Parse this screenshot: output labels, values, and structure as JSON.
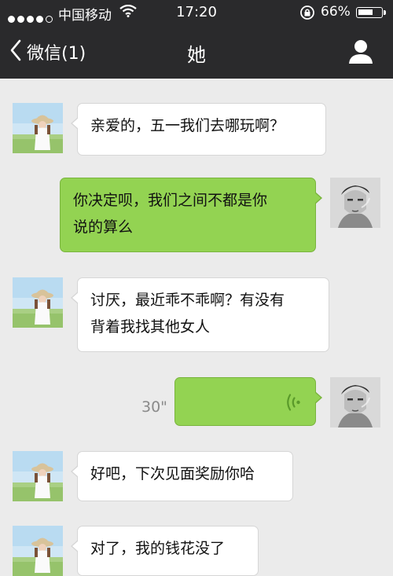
{
  "status_bar": {
    "carrier": "中国移动",
    "time": "17:20",
    "battery_percent": "66%",
    "battery_level": 0.66,
    "signal_bars_filled": 4,
    "signal_bars_total": 5,
    "icons": [
      "signal-dots-icon",
      "wifi-icon",
      "rotation-lock-icon",
      "battery-icon"
    ]
  },
  "nav": {
    "back_label": "微信",
    "unread_badge": "(1)",
    "title": "她",
    "icons": [
      "chevron-left-icon",
      "user-profile-icon"
    ]
  },
  "messages": [
    {
      "from": "her",
      "text_lines": [
        "亲爱的，五一我们去哪玩啊？"
      ]
    },
    {
      "from": "me",
      "text_lines": [
        "你决定呗，我们之间不都是你",
        "说的算么"
      ]
    },
    {
      "from": "her",
      "text_lines": [
        "讨厌，最近乖不乖啊？有没有",
        "背着我找其他女人"
      ]
    },
    {
      "from": "me",
      "type": "voice",
      "duration": "30\"",
      "icon": "voice-wave-icon"
    },
    {
      "from": "her",
      "text_lines": [
        "好吧，下次见面奖励你哈"
      ]
    },
    {
      "from": "her",
      "text_lines": [
        "对了，我的钱花没了"
      ]
    }
  ],
  "colors": {
    "nav_bg": "#2a2a2c",
    "chat_bg": "#ebebeb",
    "bubble_out": "#93d352",
    "bubble_in": "#ffffff",
    "voice_icon": "#5a9a2a"
  }
}
